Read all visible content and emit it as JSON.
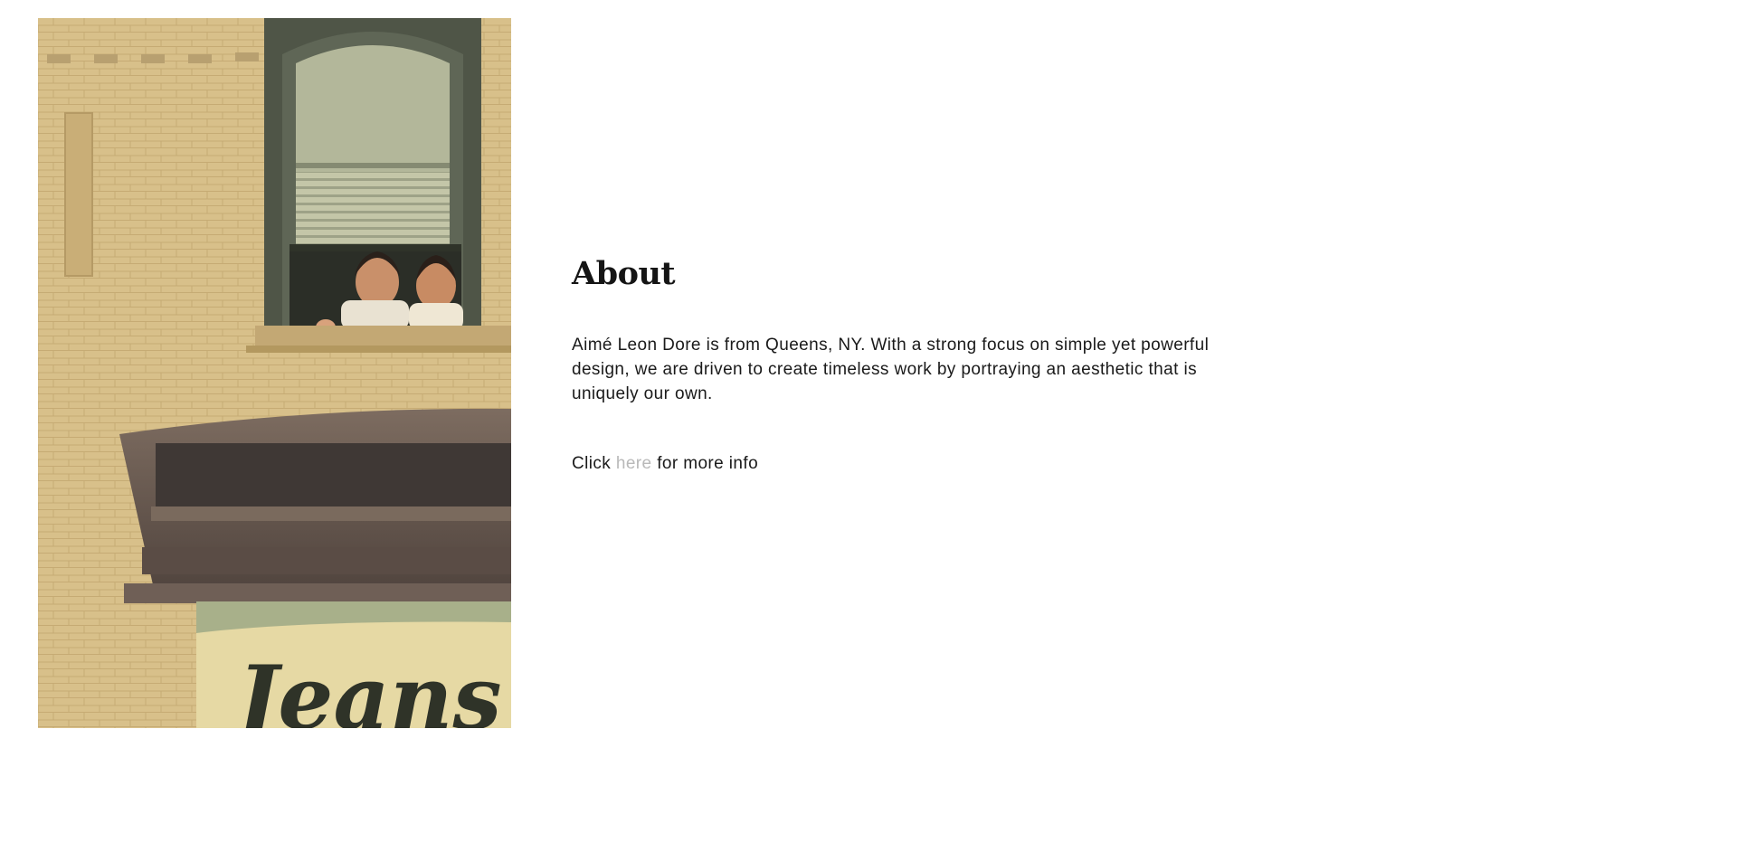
{
  "about": {
    "heading": "About",
    "description": "Aimé Leon Dore is from Queens, NY. With a strong focus on simple yet powerful design, we are driven to create timeless work by portraying an aesthetic that is uniquely our own.",
    "cta_prefix": "Click",
    "cta_link": "here",
    "cta_suffix": "for more info",
    "link_color": "#b9b9b9"
  },
  "photo": {
    "sign_text": "Jeans",
    "palette": {
      "brick": "#d8c08a",
      "window_frame": "#4f5547",
      "blind": "#b3b79a",
      "awning": "#6f5f56",
      "sign_bg": "#a8b08a",
      "sign_text": "#2f3328"
    }
  }
}
